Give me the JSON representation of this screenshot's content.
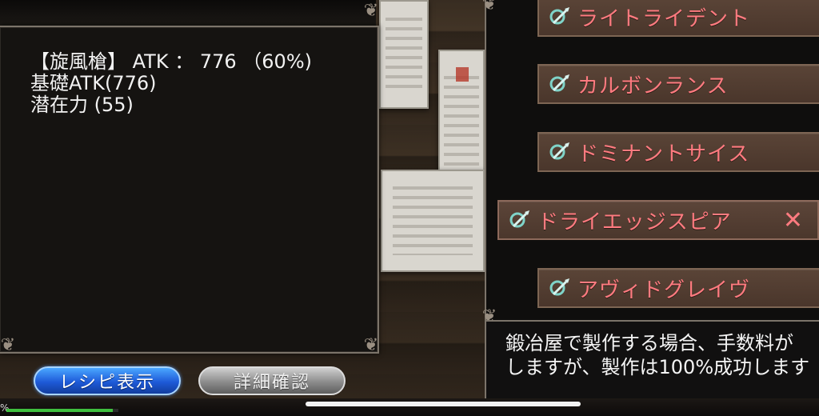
{
  "info": {
    "line1": "【旋風槍】 ATK ： 776 （60%)",
    "line2": "基礎ATK(776)",
    "line3": "潜在力 (55)"
  },
  "weapon_list": {
    "items": [
      {
        "label": "ライトライデント",
        "icon": "spear-icon",
        "selected": false
      },
      {
        "label": "カルボンランス",
        "icon": "spear-icon",
        "selected": false
      },
      {
        "label": "ドミナントサイス",
        "icon": "spear-icon",
        "selected": false
      },
      {
        "label": "ドライエッジスピア",
        "icon": "spear-icon",
        "selected": true
      },
      {
        "label": "アヴィドグレイヴ",
        "icon": "spear-icon",
        "selected": false
      }
    ],
    "close_symbol": "✕"
  },
  "description": {
    "line1": "鍛冶屋で製作する場合、手数料が",
    "line2": "しますが、製作は100%成功します"
  },
  "buttons": {
    "recipe_label": "レシピ表示",
    "detail_label": "詳細確認"
  },
  "status": {
    "percent_char": "%",
    "progress_fraction": 0.95
  },
  "colors": {
    "item_text": "#ff7b80",
    "recipe_button": "#1e5ad8",
    "detail_button": "#8c8c8c"
  }
}
